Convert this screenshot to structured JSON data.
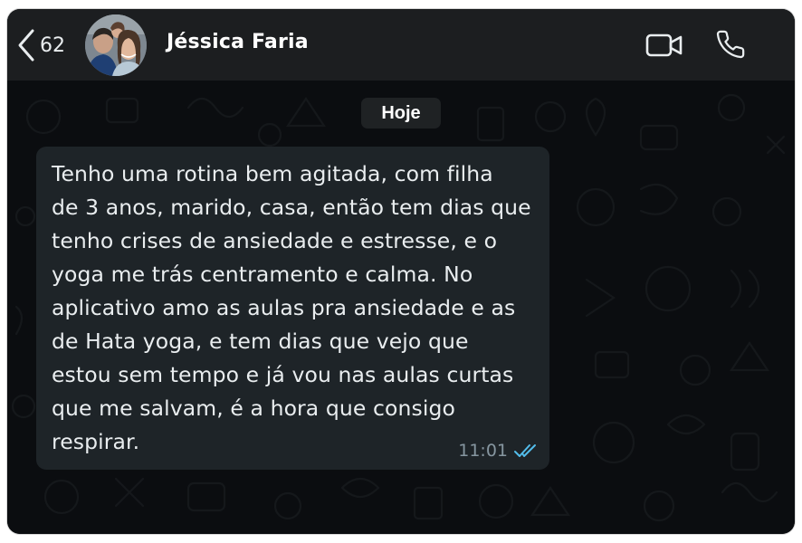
{
  "header": {
    "back_count": "62",
    "contact_name": "Jéssica Faria"
  },
  "chat": {
    "date_label": "Hoje",
    "message": {
      "text": "Tenho uma rotina bem agitada, com filha\nde 3 anos, marido, casa, então tem dias que\ntenho crises de ansiedade e estresse, e o\nyoga me trás centramento e calma. No\naplicativo amo as aulas pra ansiedade e as\nde Hata yoga, e tem dias que vejo que\nestou sem tempo e já vou nas aulas curtas\nque me salvam, é a hora que consigo\nrespirar.",
      "time": "11:01",
      "status": "read"
    }
  },
  "colors": {
    "header_bg": "#1c1e20",
    "chat_bg": "#0b0d10",
    "bubble_bg": "#1e2428",
    "text": "#e9edef",
    "muted": "#8696a0",
    "read_ticks": "#53bdeb"
  },
  "icons": {
    "back": "chevron-left-icon",
    "video": "video-camera-icon",
    "call": "phone-icon",
    "status": "double-check-icon"
  }
}
